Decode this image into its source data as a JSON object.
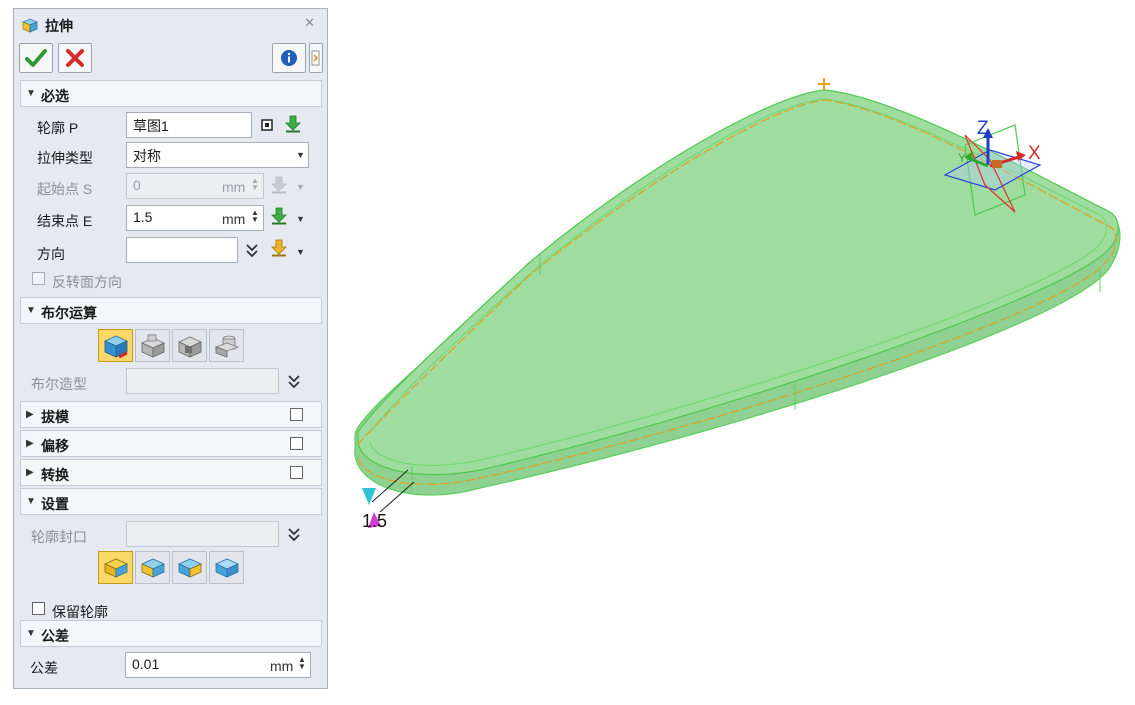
{
  "panel": {
    "title": "拉伸",
    "sections": {
      "required": "必选",
      "boolean": "布尔运算",
      "draft": "拔模",
      "offset": "偏移",
      "transform": "转换",
      "settings": "设置",
      "tolerance": "公差"
    },
    "profile": {
      "label": "轮廓 P",
      "value": "草图1"
    },
    "extrude_type": {
      "label": "拉伸类型",
      "value": "对称"
    },
    "start_point": {
      "label": "起始点 S",
      "value": "0",
      "unit": "mm"
    },
    "end_point": {
      "label": "结束点 E",
      "value": "1.5",
      "unit": "mm"
    },
    "direction": {
      "label": "方向",
      "value": ""
    },
    "reverse_face": {
      "label": "反转面方向"
    },
    "boolean_shape": {
      "label": "布尔造型",
      "value": ""
    },
    "profile_cap": {
      "label": "轮廓封口",
      "value": ""
    },
    "keep_profile": {
      "label": "保留轮廓"
    },
    "tolerance": {
      "label": "公差",
      "value": "0.01",
      "unit": "mm"
    }
  },
  "viewport": {
    "dimension_text": "1.5",
    "axis_x": "X",
    "axis_y": "Y",
    "axis_z": "Z"
  },
  "colors": {
    "accent_yellow": "#fbd867",
    "ok_green": "#2f9a2f",
    "cancel_red": "#d62a2a",
    "solid_fill": "#9ddb9f",
    "solid_edge": "#5ccf5c",
    "profile_line": "#e0a21c"
  }
}
